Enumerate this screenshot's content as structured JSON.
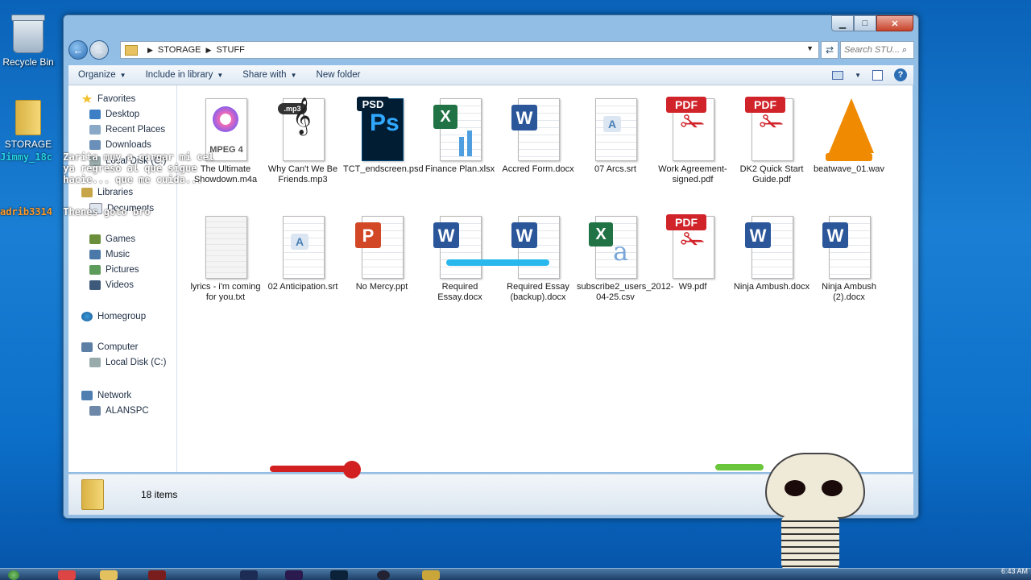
{
  "desktop": {
    "recycle_bin": "Recycle Bin",
    "storage": "STORAGE"
  },
  "window": {
    "caption_buttons": {
      "minimize": "▁",
      "maximize": "□",
      "close": "✕"
    },
    "address": {
      "root": "STORAGE",
      "folder": "STUFF"
    },
    "search_placeholder": "Search STU...",
    "toolbar": {
      "organize": "Organize",
      "include": "Include in library",
      "share": "Share with",
      "new_folder": "New folder"
    }
  },
  "navigation": {
    "favorites": "Favorites",
    "desktop": "Desktop",
    "recent": "Recent Places",
    "downloads": "Downloads",
    "local_disk_fav": "Local Disk (C:)",
    "libraries": "Libraries",
    "documents": "Documents",
    "games": "Games",
    "music": "Music",
    "pictures": "Pictures",
    "videos": "Videos",
    "homegroup": "Homegroup",
    "computer": "Computer",
    "local_disk": "Local Disk (C:)",
    "network": "Network",
    "alanspc": "ALANSPC"
  },
  "files": [
    {
      "name": "The Ultimate Showdown.m4a",
      "type": "m4a",
      "badge": "MPEG 4"
    },
    {
      "name": "Why Can't We Be Friends.mp3",
      "type": "mp3",
      "badge": ".mp3"
    },
    {
      "name": "TCT_endscreen.psd",
      "type": "psd",
      "badge": "PSD"
    },
    {
      "name": "Finance Plan.xlsx",
      "type": "xlsx",
      "badge": "X"
    },
    {
      "name": "Accred Form.docx",
      "type": "docx",
      "badge": "W"
    },
    {
      "name": "07 Arcs.srt",
      "type": "srt",
      "badge": "A"
    },
    {
      "name": "Work Agreement-signed.pdf",
      "type": "pdf",
      "badge": "PDF"
    },
    {
      "name": "DK2 Quick Start Guide.pdf",
      "type": "pdf",
      "badge": "PDF"
    },
    {
      "name": "beatwave_01.wav",
      "type": "wav",
      "badge": ""
    },
    {
      "name": "lyrics - i'm coming for you.txt",
      "type": "txt",
      "badge": ""
    },
    {
      "name": "02 Anticipation.srt",
      "type": "srt",
      "badge": "A"
    },
    {
      "name": "No Mercy.ppt",
      "type": "ppt",
      "badge": "P"
    },
    {
      "name": "Required Essay.docx",
      "type": "docx",
      "badge": "W"
    },
    {
      "name": "Required Essay (backup).docx",
      "type": "docx",
      "badge": "W"
    },
    {
      "name": "subscribe2_users_2012-04-25.csv",
      "type": "csv",
      "badge": "X"
    },
    {
      "name": "W9.pdf",
      "type": "pdf",
      "badge": "PDF"
    },
    {
      "name": "Ninja Ambush.docx",
      "type": "docx",
      "badge": "W"
    },
    {
      "name": "Ninja Ambush (2).docx",
      "type": "docx",
      "badge": "W"
    }
  ],
  "status": {
    "count": "18 items"
  },
  "clock": "6:43 AM",
  "chat_overlay": [
    {
      "user": "Jimmy_18c",
      "message": "Zarita muy a cargar mi cel ya regreso al que sigue hacie... que me cuida..."
    },
    {
      "user": "adrib3314",
      "message": "Thenes goto bro"
    }
  ],
  "colors": {
    "word": "#2b579a",
    "excel": "#217346",
    "pdf": "#d0232a",
    "psd": "#001d34",
    "ppt": "#d24726",
    "vlc": "#f08a00"
  }
}
